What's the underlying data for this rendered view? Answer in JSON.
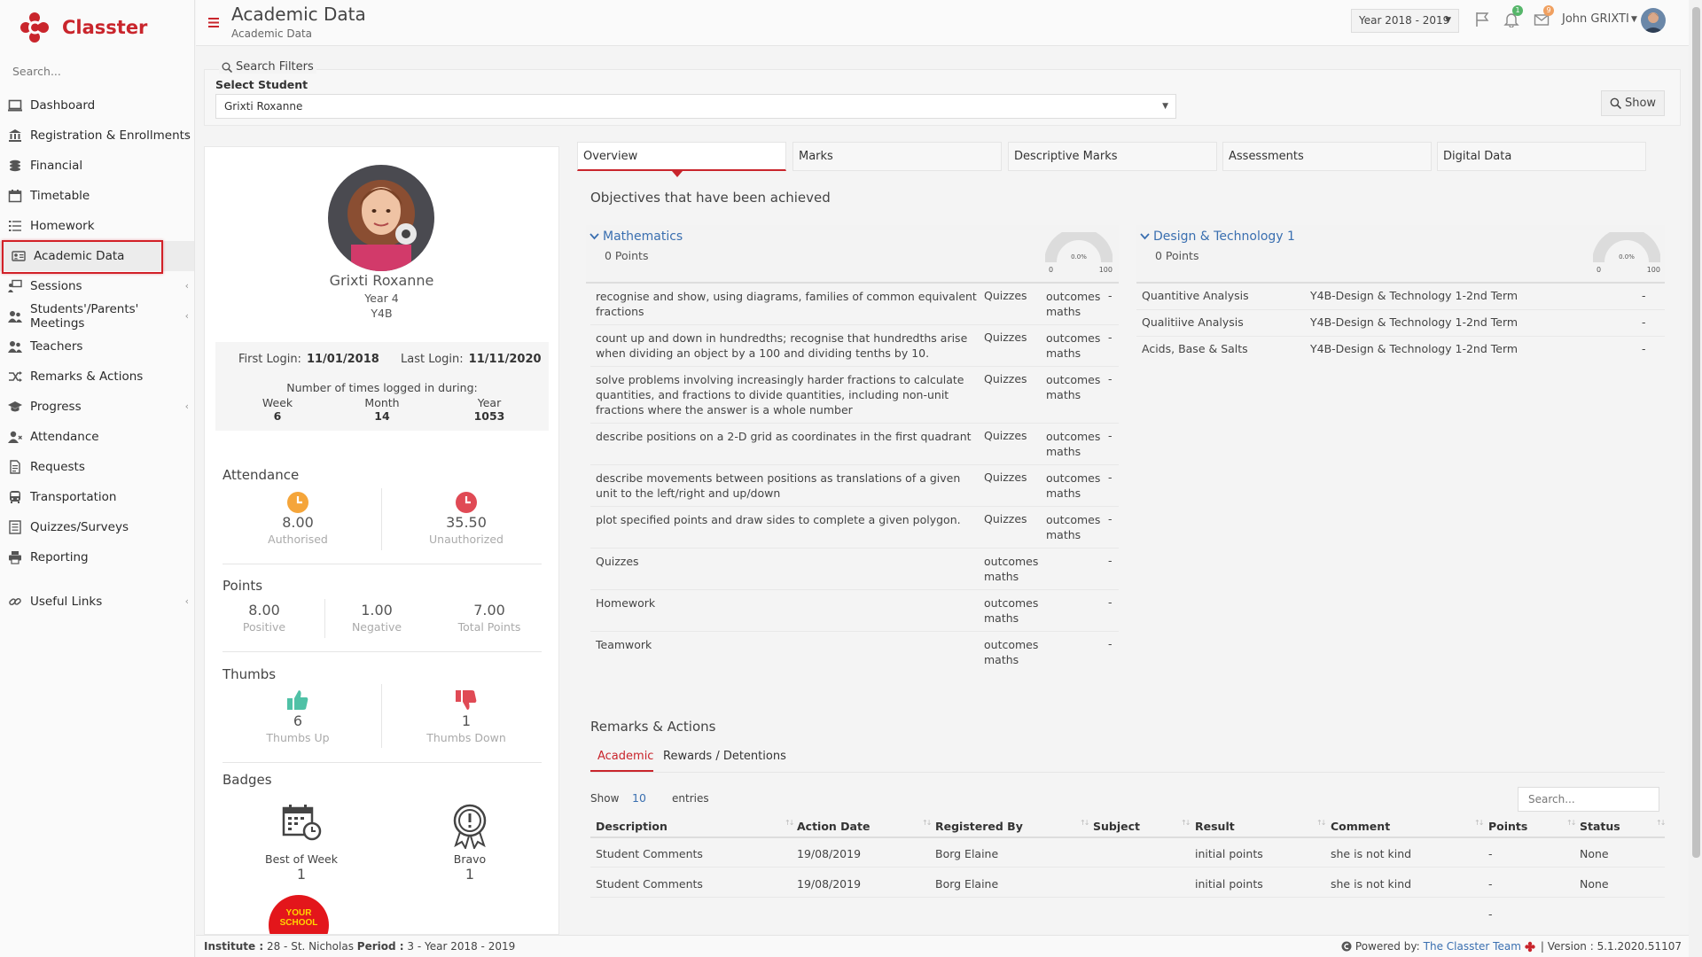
{
  "app": {
    "name": "Classter"
  },
  "sidebar": {
    "search_placeholder": "Search...",
    "items": [
      {
        "label": "Dashboard",
        "icon": "monitor-icon"
      },
      {
        "label": "Registration & Enrollments",
        "icon": "bank-icon"
      },
      {
        "label": "Financial",
        "icon": "coins-icon"
      },
      {
        "label": "Timetable",
        "icon": "calendar-icon"
      },
      {
        "label": "Homework",
        "icon": "list-icon"
      },
      {
        "label": "Academic Data",
        "icon": "id-card-icon"
      },
      {
        "label": "Sessions",
        "icon": "presentation-icon"
      },
      {
        "label": "Students'/Parents' Meetings",
        "icon": "users-icon"
      },
      {
        "label": "Teachers",
        "icon": "users-icon"
      },
      {
        "label": "Remarks & Actions",
        "icon": "shuffle-icon"
      },
      {
        "label": "Progress",
        "icon": "graduation-cap-icon"
      },
      {
        "label": "Attendance",
        "icon": "user-x-icon"
      },
      {
        "label": "Requests",
        "icon": "document-icon"
      },
      {
        "label": "Transportation",
        "icon": "bus-icon"
      },
      {
        "label": "Quizzes/Surveys",
        "icon": "checklist-icon"
      },
      {
        "label": "Reporting",
        "icon": "printer-icon"
      },
      {
        "label": "Useful Links",
        "icon": "link-icon"
      }
    ]
  },
  "header": {
    "title": "Academic Data",
    "breadcrumb": "Academic Data",
    "year_select": "Year 2018 - 2019",
    "notifications_count": "1",
    "messages_count": "9",
    "user_name": "John GRIXTI"
  },
  "filters": {
    "title": "Search Filters",
    "student_label": "Select Student",
    "student_value": "Grixti Roxanne",
    "show_button": "Show"
  },
  "profile": {
    "name": "Grixti Roxanne",
    "year": "Year 4",
    "class": "Y4B",
    "first_login_label": "First Login:",
    "first_login": "11/01/2018",
    "last_login_label": "Last Login:",
    "last_login": "11/11/2020",
    "times_logged_label": "Number of times logged in during:",
    "week_label": "Week",
    "week": "6",
    "month_label": "Month",
    "month": "14",
    "year_label": "Year",
    "year_count": "1053",
    "attendance_title": "Attendance",
    "authorised_value": "8.00",
    "authorised_label": "Authorised",
    "unauthorized_value": "35.50",
    "unauthorized_label": "Unauthorized",
    "points_title": "Points",
    "positive_value": "8.00",
    "positive_label": "Positive",
    "negative_value": "1.00",
    "negative_label": "Negative",
    "total_value": "7.00",
    "total_label": "Total Points",
    "thumbs_title": "Thumbs",
    "thumbs_up_value": "6",
    "thumbs_up_label": "Thumbs Up",
    "thumbs_down_value": "1",
    "thumbs_down_label": "Thumbs Down",
    "badges_title": "Badges",
    "badges": [
      {
        "label": "Best of Week",
        "count": "1"
      },
      {
        "label": "Bravo",
        "count": "1"
      }
    ],
    "school_badge_text": "YOUR SCHOOL"
  },
  "tabs": [
    "Overview",
    "Marks",
    "Descriptive Marks",
    "Assessments",
    "Digital Data"
  ],
  "objectives": {
    "title": "Objectives that have been achieved",
    "subjects": [
      {
        "name": "Mathematics",
        "points": "0 Points",
        "gauge": {
          "value": "0.0%",
          "min": "0",
          "max": "100"
        },
        "rows": [
          {
            "desc": "recognise and show, using diagrams, families of common equivalent fractions",
            "type": "Quizzes",
            "outcome": "outcomes maths",
            "val": "-"
          },
          {
            "desc": "count up and down in hundredths; recognise that hundredths arise when dividing an object by a 100 and dividing tenths by 10.",
            "type": "Quizzes",
            "outcome": "outcomes maths",
            "val": "-"
          },
          {
            "desc": "solve problems involving increasingly harder fractions to calculate quantities, and fractions to divide quantities, including non-unit fractions where the answer is a whole number",
            "type": "Quizzes",
            "outcome": "outcomes maths",
            "val": "-"
          },
          {
            "desc": "describe positions on a 2-D grid as coordinates in the first quadrant",
            "type": "Quizzes",
            "outcome": "outcomes maths",
            "val": "-"
          },
          {
            "desc": "describe movements between positions as translations of a given unit to the left/right and up/down",
            "type": "Quizzes",
            "outcome": "outcomes maths",
            "val": "-"
          },
          {
            "desc": "plot specified points and draw sides to complete a given polygon.",
            "type": "Quizzes",
            "outcome": "outcomes maths",
            "val": "-"
          },
          {
            "desc": "Quizzes",
            "type": "",
            "outcome": "outcomes maths",
            "val": "-"
          },
          {
            "desc": "Homework",
            "type": "",
            "outcome": "outcomes maths",
            "val": "-"
          },
          {
            "desc": "Teamwork",
            "type": "",
            "outcome": "outcomes maths",
            "val": "-"
          }
        ]
      },
      {
        "name": "Design & Technology 1",
        "points": "0 Points",
        "gauge": {
          "value": "0.0%",
          "min": "0",
          "max": "100"
        },
        "rows": [
          {
            "desc": "Quantitive Analysis",
            "term": "Y4B-Design & Technology 1-2nd Term",
            "val": "-"
          },
          {
            "desc": "Qualitiive Analysis",
            "term": "Y4B-Design & Technology 1-2nd Term",
            "val": "-"
          },
          {
            "desc": "Acids, Base & Salts",
            "term": "Y4B-Design & Technology 1-2nd Term",
            "val": "-"
          }
        ]
      }
    ]
  },
  "remarks": {
    "title": "Remarks & Actions",
    "tabs": [
      "Academic",
      "Rewards / Detentions"
    ],
    "show_label": "Show",
    "show_count": "10",
    "entries_label": "entries",
    "search_placeholder": "Search...",
    "columns": [
      "Description",
      "Action Date",
      "Registered By",
      "Subject",
      "Result",
      "Comment",
      "Points",
      "Status"
    ],
    "rows": [
      [
        "Student Comments",
        "19/08/2019",
        "Borg Elaine",
        "",
        "initial points",
        "she is not kind",
        "-",
        "None"
      ],
      [
        "Student Comments",
        "19/08/2019",
        "Borg Elaine",
        "",
        "initial points",
        "she is not kind",
        "-",
        "None"
      ]
    ],
    "trailing_dash": "-"
  },
  "footer": {
    "institute_label": "Institute :",
    "institute_value": "28 - St. Nicholas",
    "period_label": "Period :",
    "period_value": "3 - Year 2018 - 2019",
    "powered_label": "Powered by:",
    "powered_link": "The Classter Team",
    "version": "| Version : 5.1.2020.51107"
  },
  "colors": {
    "brand": "#c9252c",
    "link": "#3a6fb0",
    "authorised": "#f5a53a",
    "unauthorized": "#e04a55",
    "thumbs_up": "#4fc1a6",
    "thumbs_down": "#e04a55"
  }
}
